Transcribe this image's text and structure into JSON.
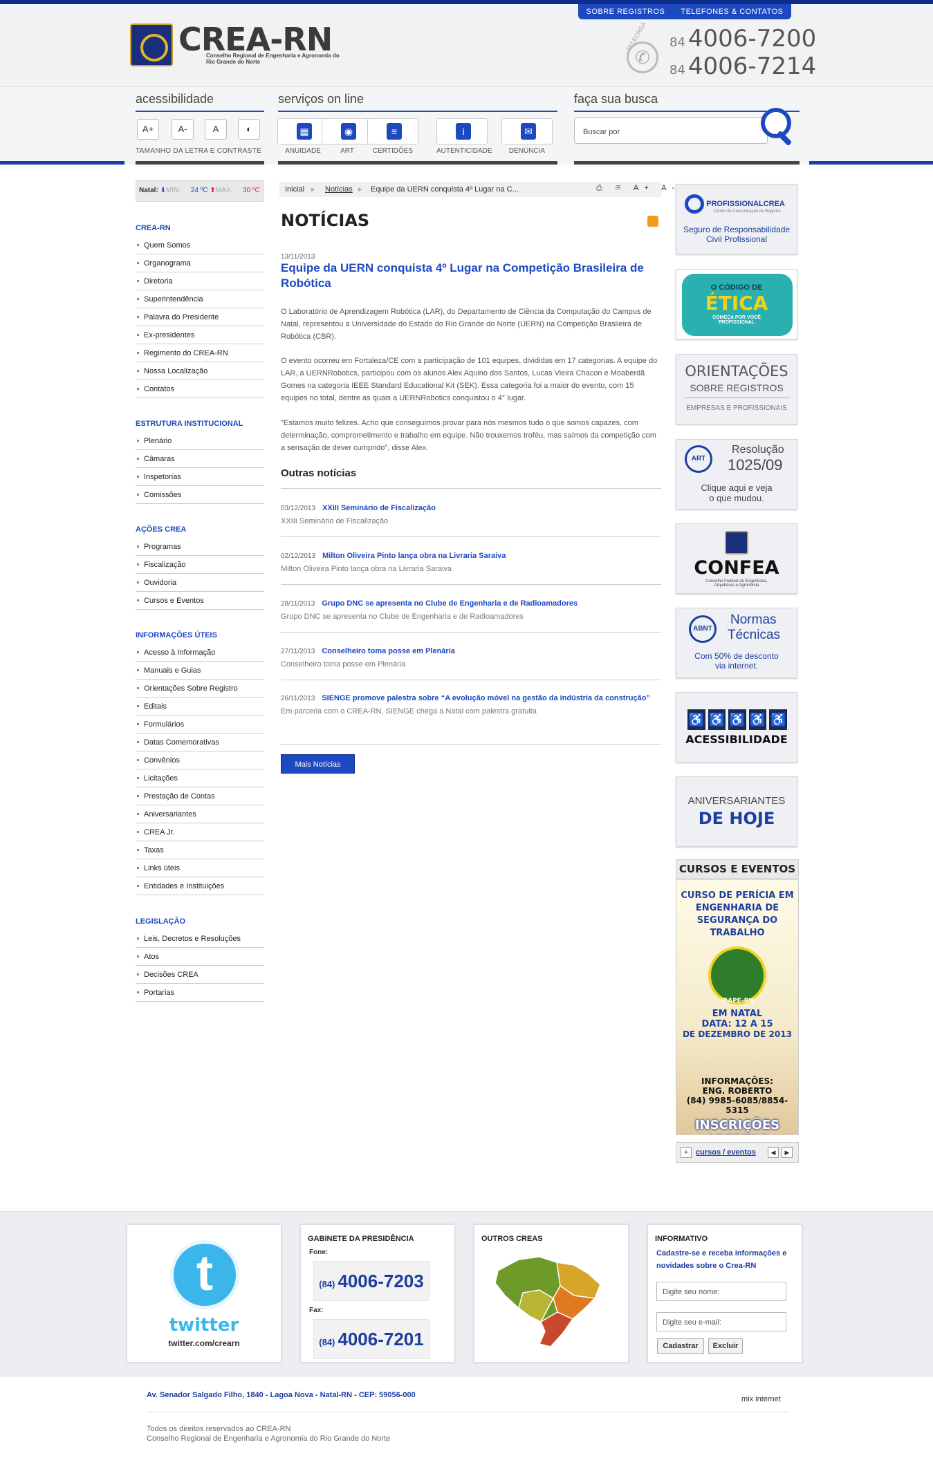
{
  "header": {
    "logo_title": "CREA-RN",
    "logo_subtitle": "Conselho Regional de Engenharia e Agronomia do Rio Grande do Norte",
    "top_links": [
      "SOBRE REGISTROS",
      "TELEFONES & CONTATOS"
    ],
    "telecrea_label": "TELECREA",
    "phones": [
      {
        "ddd": "84",
        "number": "4006-7200"
      },
      {
        "ddd": "84",
        "number": "4006-7214"
      }
    ]
  },
  "toolbar": {
    "accessibility_title": "acessibilidade",
    "accessibility_buttons": [
      "A+",
      "A-",
      "A",
      "◐"
    ],
    "accessibility_label": "TAMANHO DA LETRA E CONTRASTE",
    "services_title": "serviços on line",
    "services": [
      "ANUIDADE",
      "ART",
      "CERTIDÕES",
      "AUTENTICIDADE",
      "DENÚNCIA"
    ],
    "search_title": "faça sua busca",
    "search_placeholder": "Buscar por"
  },
  "weather": {
    "city": "Natal:",
    "min_label": "MIN.",
    "min": "24 ºC",
    "max_label": "MAX.",
    "max": "30 ºC"
  },
  "sidebar": [
    {
      "title": "CREA-RN",
      "items": [
        "Quem Somos",
        "Organograma",
        "Diretoria",
        "Superintendência",
        "Palavra do Presidente",
        "Ex-presidentes",
        "Regimento do CREA-RN",
        "Nossa Localização",
        "Contatos"
      ]
    },
    {
      "title": "ESTRUTURA INSTITUCIONAL",
      "items": [
        "Plenário",
        "Câmaras",
        "Inspetorias",
        "Comissões"
      ]
    },
    {
      "title": "AÇÕES CREA",
      "items": [
        "Programas",
        "Fiscalização",
        "Ouvidoria",
        "Cursos e Eventos"
      ]
    },
    {
      "title": "INFORMAÇÕES ÚTEIS",
      "items": [
        "Acesso à Informação",
        "Manuais e Guias",
        "Orientações Sobre Registro",
        "Editais",
        "Formulários",
        "Datas Comemorativas",
        "Convênios",
        "Licitações",
        "Prestação de Contas",
        "Aniversariantes",
        "CREA Jr.",
        "Taxas",
        "Links úteis",
        "Entidades e Instituições"
      ]
    },
    {
      "title": "LEGISLAÇÃO",
      "items": [
        "Leis, Decretos e Resoluções",
        "Atos",
        "Decisões CREA",
        "Portarias"
      ]
    }
  ],
  "breadcrumb": [
    "Inicial",
    "Notícias",
    "Equipe da UERN conquista 4º Lugar na C..."
  ],
  "page_tools": "⎙ ✉ A+ A-",
  "main": {
    "title": "NOTÍCIAS",
    "article_date": "13/11/2013",
    "article_title": "Equipe da UERN conquista 4º Lugar na Competição Brasileira de Robótica",
    "paragraphs": [
      "O Laboratório de Aprendizagem Robótica (LAR), do Departamento de Ciência da Computação do Campus de Natal, representou a Universidade do Estado do Rio Grande do Norte (UERN) na Competição Brasileira de Robótica (CBR).",
      "O evento ocorreu em Fortaleza/CE com a participação de 101 equipes, divididas em 17 categorias. A equipe do LAR, a UERNRobotics, participou com os alunos Alex Aquino dos Santos, Lucas Vieira Chacon e Moaberdã Gomes na categoria IEEE Standard Educational Kit (SEK). Essa categoria foi a maior do evento, com 15 equipes no total, dentre as quais a UERNRobotics conquistou o 4° lugar.",
      "\"Estamos muito felizes. Acho que conseguimos provar para nós mesmos tudo o que somos capazes, com determinação, comprometimento e trabalho em equipe. Não trouxemos troféu, mas saímos da competição com a sensação de dever cumprido\", disse Alex."
    ],
    "other_title": "Outras notícias",
    "other_news": [
      {
        "date": "03/12/2013",
        "title": "XXIII Seminário de Fiscalização",
        "summary": "XXIII Seminário de Fiscalização"
      },
      {
        "date": "02/12/2013",
        "title": "Milton Oliveira Pinto lança obra na Livraria Saraiva",
        "summary": "Milton Oliveira Pinto lança obra na Livraria Saraiva"
      },
      {
        "date": "28/11/2013",
        "title": "Grupo DNC se apresenta no Clube de Engenharia e de Radioamadores",
        "summary": "Grupo DNC se apresenta no Clube de Engenharia e de Radioamadores"
      },
      {
        "date": "27/11/2013",
        "title": "Conselheiro toma posse em Plenária",
        "summary": "Conselheiro toma posse em Plenária"
      },
      {
        "date": "26/11/2013",
        "title": "SIENGE promove palestra sobre “A evolução móvel na gestão da indústria da construção”",
        "summary": "Em parceria com o CREA-RN, SIENGE chega a Natal com palestra gratuita"
      }
    ],
    "more_button": "Mais Notícias"
  },
  "banners": {
    "profissional": {
      "brand": "PROFISSIONALCREA",
      "tag": "Centro de Comunicação de Registro",
      "text": "Seguro de Responsabilidade Civil Profissional"
    },
    "etica": {
      "l1": "O CÓDIGO DE",
      "l2": "ÉTICA",
      "l3": "COMEÇA POR VOCÊ PROFISSIONAL"
    },
    "orientacoes": {
      "l1": "ORIENTAÇÕES",
      "l2": "SOBRE REGISTROS",
      "l3": "EMPRESAS E PROFISSIONAIS"
    },
    "resolucao": {
      "badge": "ART",
      "l1": "Resolução",
      "l2": "1025/09",
      "l3": "Clique aqui e veja o que mudou."
    },
    "confea": {
      "l1": "CONFEA",
      "l2": "Conselho Federal de Engenharia, Arquitetura e Agronomia"
    },
    "abnt": {
      "badge": "ABNT",
      "l1": "Normas",
      "l2": "Técnicas",
      "l3": "Com 50% de desconto via internet."
    },
    "acessibilidade": {
      "l1": "ACESSIBILIDADE"
    },
    "aniversariantes": {
      "l1": "ANIVERSARIANTES",
      "l2": "DE HOJE"
    }
  },
  "cursos": {
    "title": "CURSOS E EVENTOS",
    "headline": "CURSO DE PERÍCIA EM ENGENHARIA DE SEGURANÇA DO TRABALHO",
    "seal": "IBAPE-RN",
    "where": "EM NATAL",
    "dates": "DATA: 12 A 15",
    "dates2": "DE DEZEMBRO DE 2013",
    "info": "INFORMAÇÕES:",
    "contact": "ENG. ROBERTO",
    "phone": "(84) 9985-6085/8854-5315",
    "cta": "INSCRIÇÕES ABERTAS",
    "nav_label": "cursos / eventos"
  },
  "footer": {
    "twitter": {
      "word": "twitter",
      "handle": "twitter.com/crearn"
    },
    "gabinete": {
      "title": "GABINETE DA PRESIDÊNCIA",
      "fone_label": "Fone:",
      "fone_ddd": "(84)",
      "fone": "4006-7203",
      "fax_label": "Fax:",
      "fax_ddd": "(84)",
      "fax": "4006-7201"
    },
    "outros": {
      "title": "OUTROS CREAS"
    },
    "informativo": {
      "title": "INFORMATIVO",
      "text": "Cadastre-se e receba informações e novidades sobre o Crea-RN",
      "name_placeholder": "Digite seu nome:",
      "email_placeholder": "Digite seu e-mail:",
      "submit": "Cadastrar",
      "clear": "Excluir"
    },
    "address": "Av. Senador Salgado Filho, 1840 - Lagoa Nova - Natal-RN - CEP: 59056-000",
    "credit": "mix internet",
    "copyright1": "Todos os direitos reservados ao CREA-RN",
    "copyright2": "Conselho Regional de Engenharia e Agronomia do Rio Grande do Norte"
  }
}
